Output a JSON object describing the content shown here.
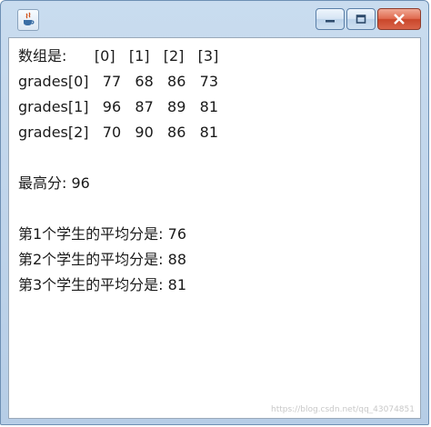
{
  "window": {
    "title": "",
    "icon": "java-app-icon",
    "controls": [
      "minimize-icon",
      "maximize-icon",
      "close-icon"
    ]
  },
  "console": {
    "header": "数组是:      [0]   [1]   [2]   [3]",
    "rows": [
      "grades[0]   77   68   86   73",
      "grades[1]   96   87   89   81",
      "grades[2]   70   90   86   81"
    ],
    "max_line": "最高分: 96",
    "averages": [
      "第1个学生的平均分是: 76",
      "第2个学生的平均分是: 88",
      "第3个学生的平均分是: 81"
    ]
  },
  "watermark": "https://blog.csdn.net/qq_43074851"
}
